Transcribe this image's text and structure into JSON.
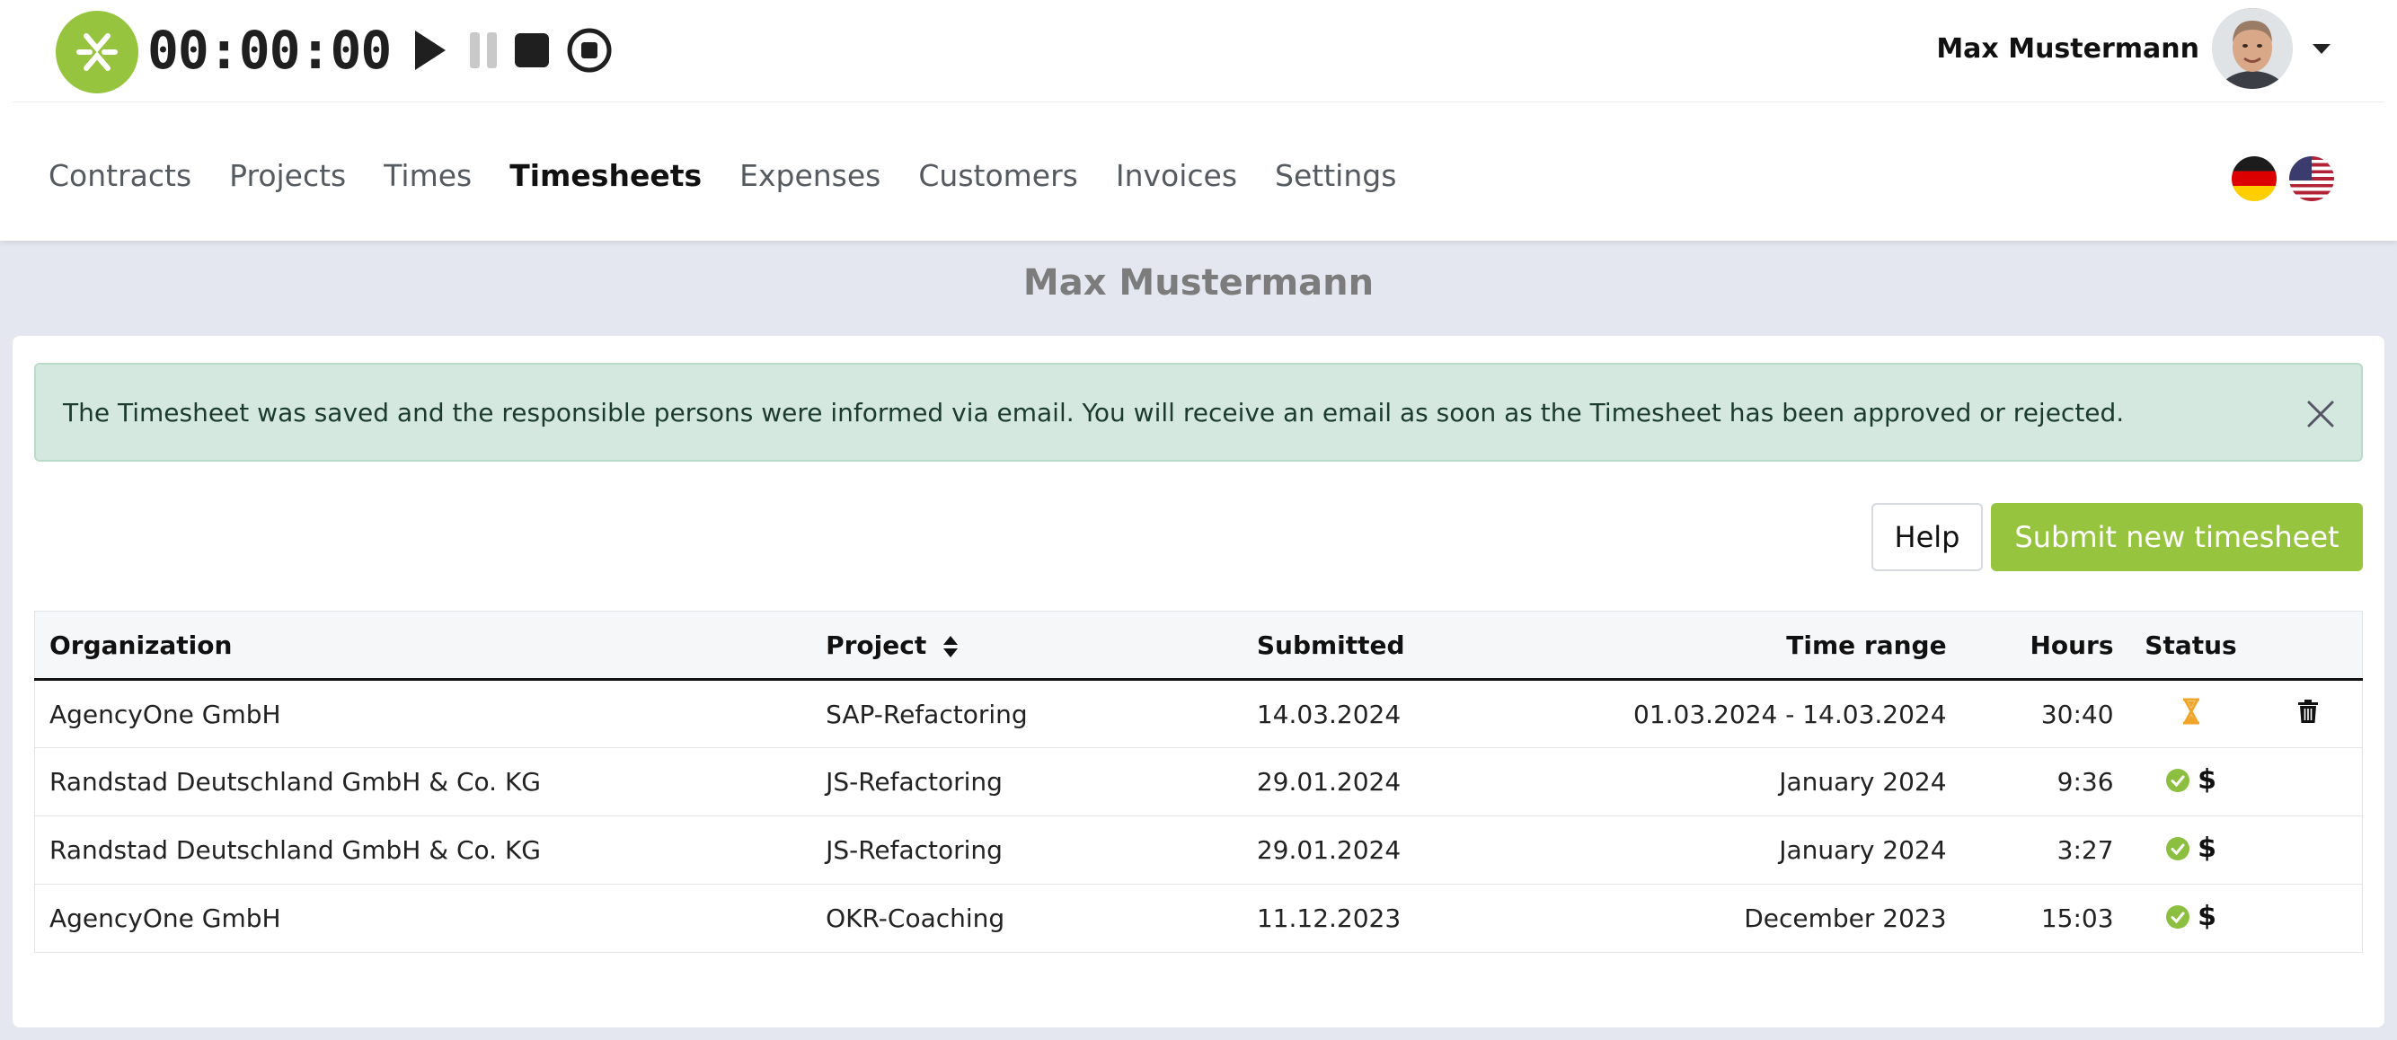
{
  "timer": {
    "display": "00:00:00",
    "controls": {
      "play_icon": "play-icon",
      "pause_icon": "pause-icon",
      "stop_icon": "stop-icon",
      "record_icon": "stop-circle-icon"
    }
  },
  "user": {
    "name": "Max Mustermann"
  },
  "nav": {
    "items": [
      "Contracts",
      "Projects",
      "Times",
      "Timesheets",
      "Expenses",
      "Customers",
      "Invoices",
      "Settings"
    ],
    "active": "Timesheets"
  },
  "languages": [
    "de",
    "us"
  ],
  "page": {
    "title": "Max Mustermann"
  },
  "alert": {
    "message": "The Timesheet was saved and the responsible persons were informed via email. You will receive an email as soon as the Timesheet has been approved or rejected."
  },
  "buttons": {
    "help": "Help",
    "submit": "Submit new timesheet"
  },
  "table": {
    "headers": {
      "organization": "Organization",
      "project": "Project",
      "submitted": "Submitted",
      "time_range": "Time range",
      "hours": "Hours",
      "status": "Status"
    },
    "rows": [
      {
        "organization": "AgencyOne GmbH",
        "project": "SAP-Refactoring",
        "submitted": "14.03.2024",
        "time_range": "01.03.2024 - 14.03.2024",
        "hours": "30:40",
        "status": "pending"
      },
      {
        "organization": "Randstad Deutschland GmbH & Co. KG",
        "project": "JS-Refactoring",
        "submitted": "29.01.2024",
        "time_range": "January 2024",
        "hours": "9:36",
        "status": "approved-invoiced"
      },
      {
        "organization": "Randstad Deutschland GmbH & Co. KG",
        "project": "JS-Refactoring",
        "submitted": "29.01.2024",
        "time_range": "January 2024",
        "hours": "3:27",
        "status": "approved-invoiced"
      },
      {
        "organization": "AgencyOne GmbH",
        "project": "OKR-Coaching",
        "submitted": "11.12.2023",
        "time_range": "December 2023",
        "hours": "15:03",
        "status": "approved-invoiced"
      }
    ],
    "status_symbols": {
      "invoiced": "$"
    }
  },
  "colors": {
    "brand_green": "#96c43e",
    "alert_bg": "#d4e8df",
    "pending": "#f0a52a",
    "approved": "#8cbf3f"
  }
}
